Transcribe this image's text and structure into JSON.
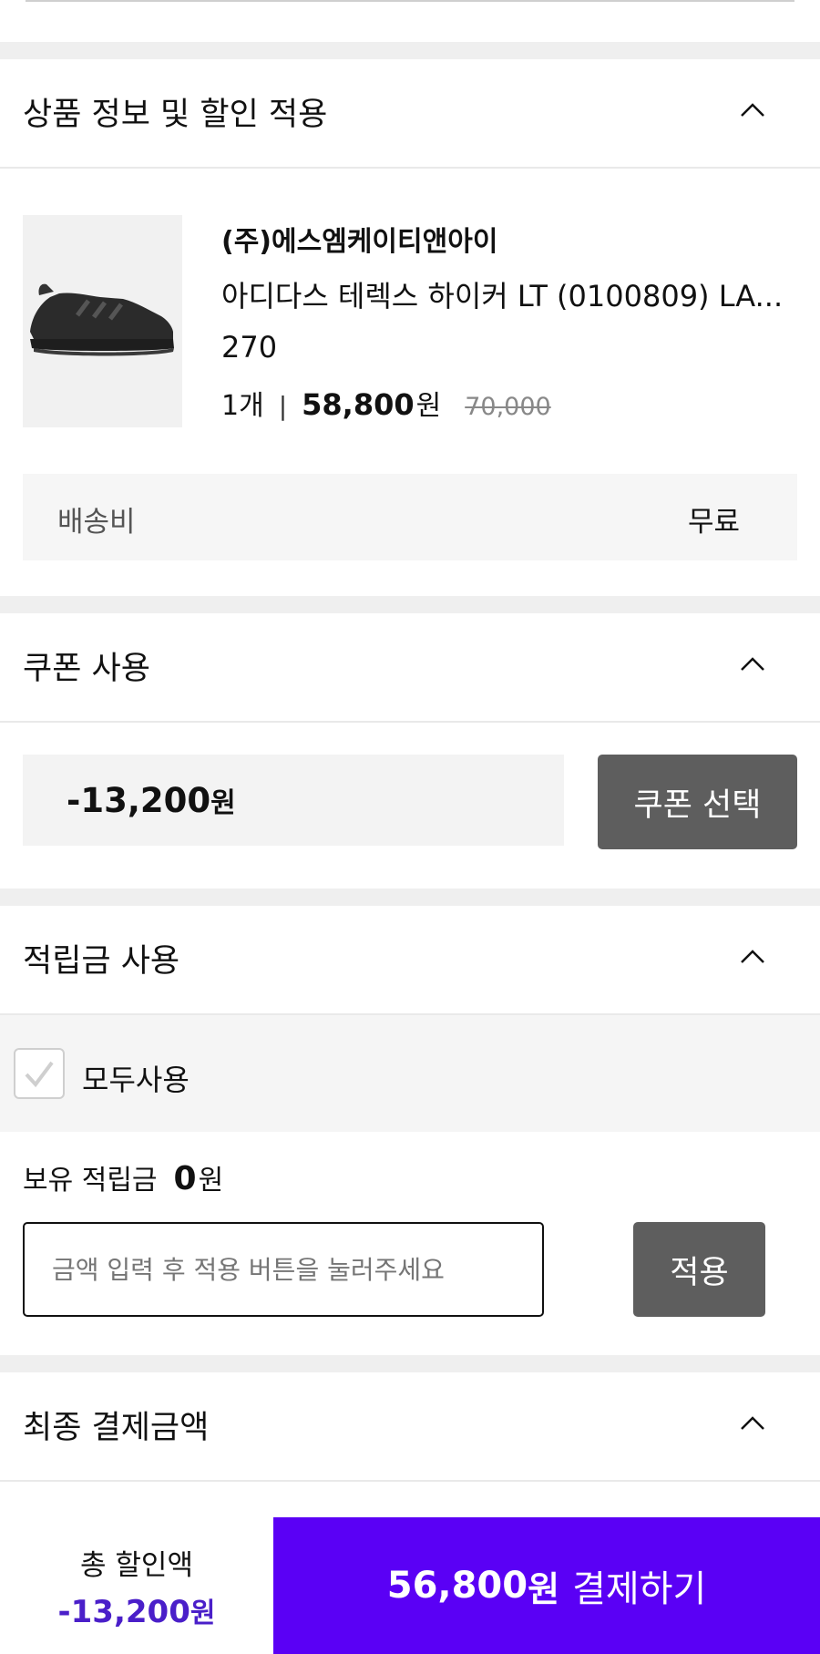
{
  "sections": {
    "product": {
      "title": "상품 정보 및 할인 적용"
    },
    "coupon": {
      "title": "쿠폰 사용"
    },
    "points": {
      "title": "적립금 사용"
    },
    "final": {
      "title": "최종 결제금액"
    }
  },
  "product": {
    "seller": "(주)에스엠케이티앤아이",
    "name": "아디다스 테렉스 하이커 LT (0100809) LA...",
    "option": "270",
    "quantity": "1개",
    "separator": "|",
    "price": "58,800",
    "price_unit": "원",
    "original_price": "70,000",
    "image_icon": "sneaker-image"
  },
  "shipping": {
    "label": "배송비",
    "value": "무료"
  },
  "coupon": {
    "amount": "-13,200",
    "unit": "원",
    "button": "쿠폰 선택"
  },
  "points": {
    "use_all_label": "모두사용",
    "use_all_checked": true,
    "balance_label": "보유 적립금",
    "balance_value": "0",
    "balance_unit": "원",
    "input_placeholder": "금액 입력 후 적용 버튼을 눌러주세요",
    "apply_button": "적용"
  },
  "bottom_bar": {
    "discount_label": "총 할인액",
    "discount_value": "-13,200",
    "discount_unit": "원",
    "pay_amount": "56,800",
    "pay_unit": "원",
    "pay_label": "결제하기"
  },
  "colors": {
    "accent": "#5a00f5",
    "accent_text": "#4a1fc9",
    "button_gray": "#5e5e5e"
  }
}
